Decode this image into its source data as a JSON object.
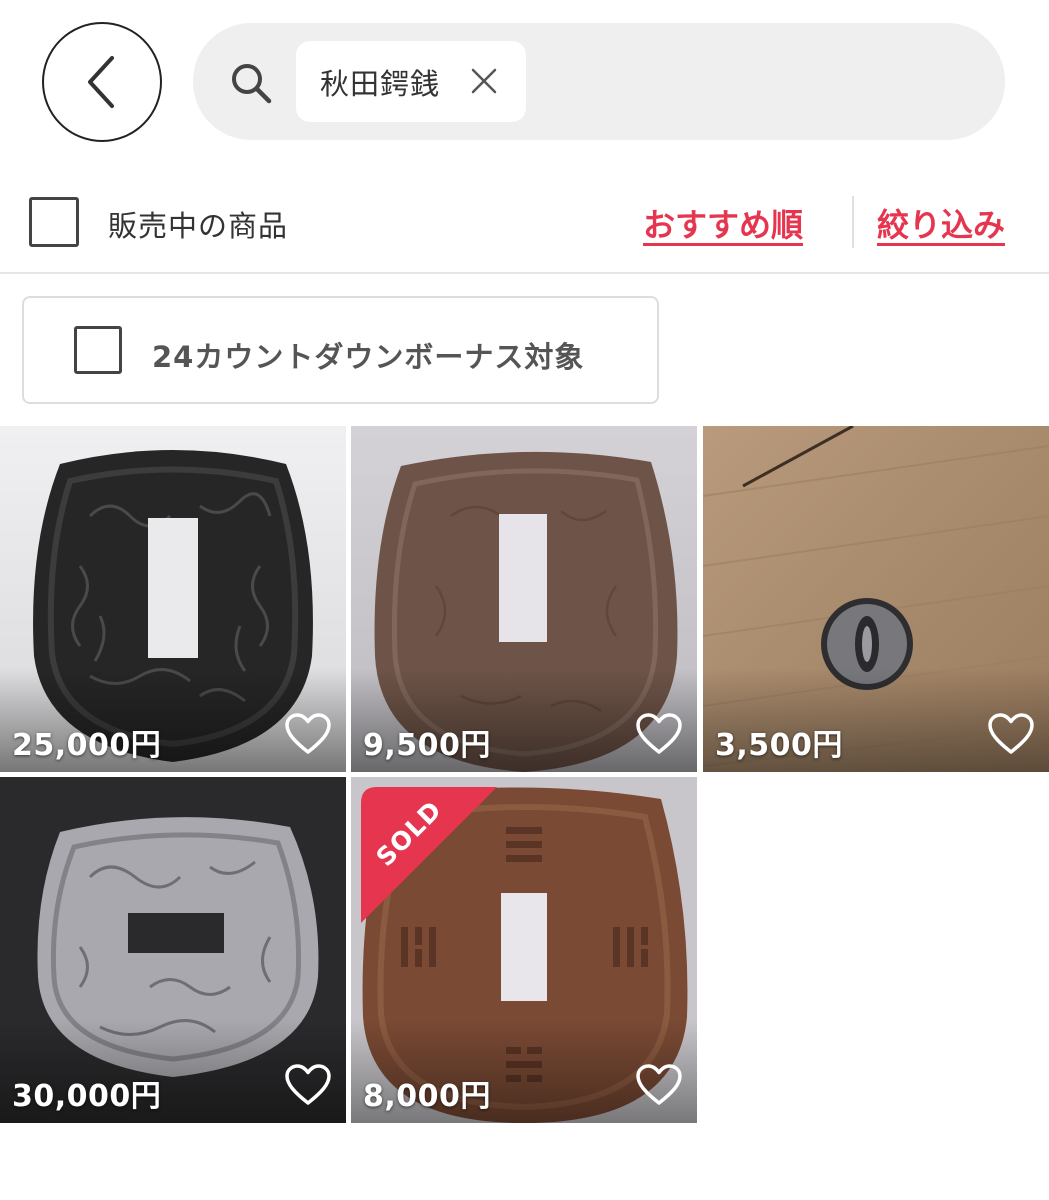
{
  "header": {
    "back_icon": "chevron-left-icon",
    "search_icon": "search-icon",
    "search_chip": {
      "label": "秋田鍔銭",
      "close_icon": "close-icon"
    }
  },
  "filters": {
    "on_sale_label": "販売中の商品",
    "sort_label": "おすすめ順",
    "refine_label": "絞り込み",
    "bonus_label": "24カウントダウンボーナス対象"
  },
  "items": [
    {
      "price": "25,000円",
      "favorite_icon": "heart-outline-icon",
      "sold": false
    },
    {
      "price": "9,500円",
      "favorite_icon": "heart-outline-icon",
      "sold": false
    },
    {
      "price": "3,500円",
      "favorite_icon": "heart-outline-icon",
      "sold": false
    },
    {
      "price": "30,000円",
      "favorite_icon": "heart-outline-icon",
      "sold": false
    },
    {
      "price": "8,000円",
      "favorite_icon": "heart-outline-icon",
      "sold": true,
      "badge": "SOLD"
    }
  ],
  "colors": {
    "accent": "#e5354f",
    "search_bg": "#efefef"
  }
}
